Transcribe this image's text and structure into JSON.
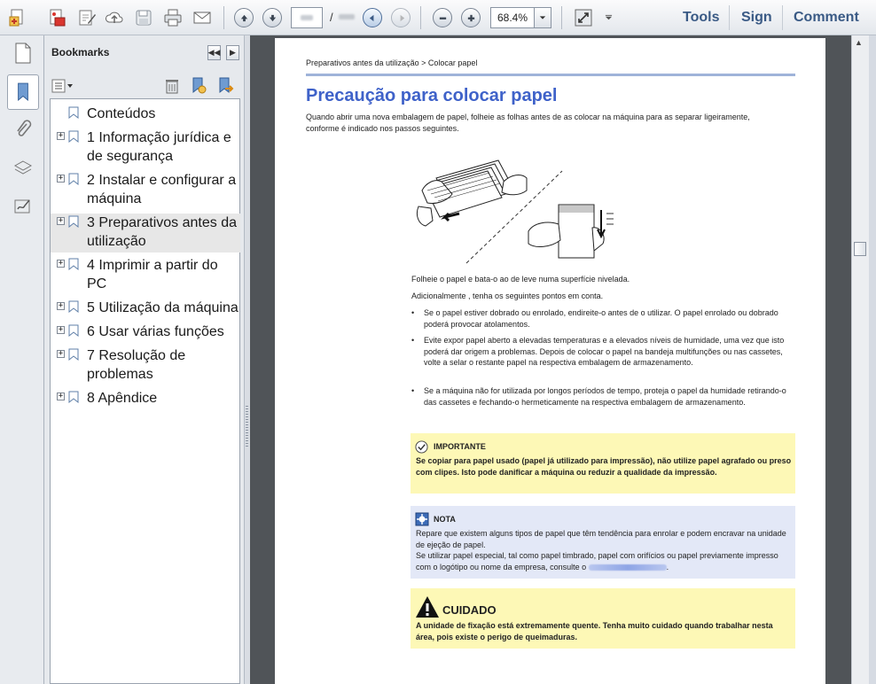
{
  "toolbar": {
    "page_current": "",
    "page_separator": "/",
    "zoom": "68.4%",
    "tools_label": "Tools",
    "sign_label": "Sign",
    "comment_label": "Comment"
  },
  "bookmarks": {
    "title": "Bookmarks",
    "items": [
      {
        "label": "Conteúdos",
        "expandable": false
      },
      {
        "label": "1 Informação jurídica e de segurança",
        "expandable": true
      },
      {
        "label": "2 Instalar e configurar a máquina",
        "expandable": true
      },
      {
        "label": "3 Preparativos antes da utilização",
        "expandable": true,
        "selected": true
      },
      {
        "label": "4 Imprimir a partir do PC",
        "expandable": true
      },
      {
        "label": "5 Utilização da máquina",
        "expandable": true
      },
      {
        "label": "6 Usar várias funções",
        "expandable": true
      },
      {
        "label": "7 Resolução de problemas",
        "expandable": true
      },
      {
        "label": "8 Apêndice",
        "expandable": true
      }
    ],
    "expand_glyph": "+"
  },
  "page": {
    "breadcrumb": "Preparativos antes da utilização > Colocar papel",
    "title": "Precaução para colocar papel",
    "intro": "Quando abrir uma nova embalagem de papel, folheie as folhas antes de as colocar na máquina para as separar ligeiramente, conforme é indicado nos passos seguintes.",
    "step": "Folheie o papel e bata-o ao de leve numa superfície nivelada.",
    "additional": "Adicionalmente , tenha os seguintes pontos em conta.",
    "bullet_char": "•",
    "bullets": [
      "Se o papel estiver dobrado ou enrolado, endireite-o antes de o utilizar. O papel enrolado ou dobrado poderá provocar atolamentos.",
      "Evite expor papel aberto a elevadas temperaturas e a elevados níveis de humidade, uma vez que isto poderá dar origem a problemas. Depois de colocar o papel na bandeja multifunções ou nas cassetes, volte a selar o restante papel na respectiva embalagem de armazenamento.",
      "Se a máquina não for utilizada por longos períodos de tempo, proteja o papel da humidade retirando-o das cassetes e fechando-o hermeticamente na respectiva embalagem de armazenamento."
    ],
    "important": {
      "head": "IMPORTANTE",
      "body": "Se copiar para papel usado (papel já utilizado para impressão), não utilize papel agrafado ou preso com clipes. Isto pode danificar a máquina ou reduzir a qualidade da impressão."
    },
    "note": {
      "head": "NOTA",
      "line1": "Repare que existem alguns tipos de papel que têm tendência para enrolar e podem encravar na unidade de ejeção de papel.",
      "line2": "Se utilizar papel especial, tal como papel timbrado, papel com orifícios ou papel previamente impresso com o logótipo ou nome da empresa, consulte o",
      "line2_end": "."
    },
    "caution": {
      "head": "CUIDADO",
      "body": "A unidade de fixação está extremamente quente. Tenha muito cuidado quando trabalhar nesta área, pois existe o perigo de queimaduras."
    }
  },
  "icons": [
    "create-pdf-icon",
    "edit-pdf-icon",
    "sign-form-icon",
    "upload-cloud-icon",
    "save-icon",
    "print-icon",
    "email-icon",
    "previous-page-icon",
    "next-page-icon",
    "previous-view-icon",
    "next-view-icon",
    "zoom-out-icon",
    "zoom-in-icon",
    "fit-page-icon",
    "toolbar-options-icon",
    "pages-panel-icon",
    "bookmarks-panel-icon",
    "attachments-panel-icon",
    "layers-panel-icon",
    "signatures-panel-icon",
    "options-menu-icon",
    "delete-bookmark-icon",
    "new-bookmark-icon",
    "expand-bookmark-icon",
    "bookmark-icon",
    "important-check-icon",
    "note-icon",
    "caution-warning-icon"
  ],
  "colors": {
    "title_blue": "#3f62c9",
    "important_bg": "#fdf8b6",
    "note_bg": "#e3e8f7",
    "doc_bg": "#505458"
  }
}
